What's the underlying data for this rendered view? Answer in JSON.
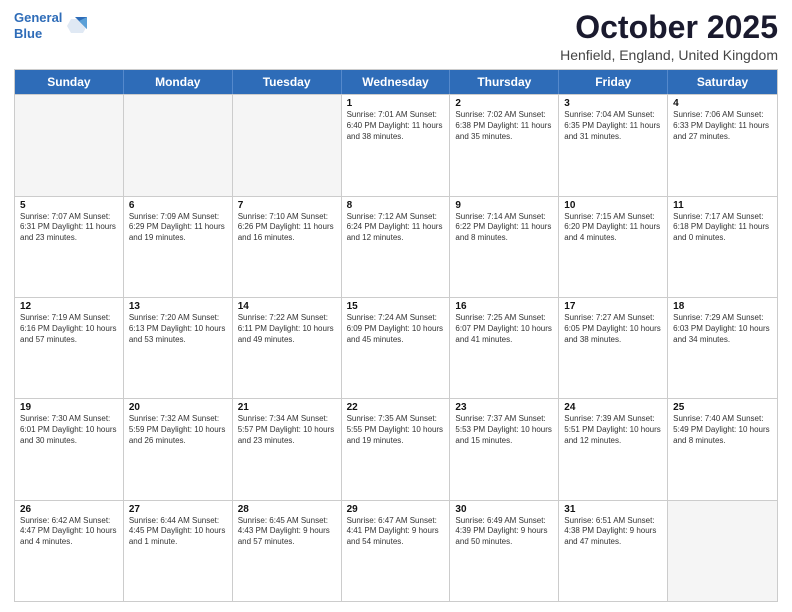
{
  "logo": {
    "line1": "General",
    "line2": "Blue"
  },
  "header": {
    "month": "October 2025",
    "location": "Henfield, England, United Kingdom"
  },
  "days": [
    "Sunday",
    "Monday",
    "Tuesday",
    "Wednesday",
    "Thursday",
    "Friday",
    "Saturday"
  ],
  "rows": [
    [
      {
        "day": "",
        "empty": true
      },
      {
        "day": "",
        "empty": true
      },
      {
        "day": "",
        "empty": true
      },
      {
        "day": "1",
        "info": "Sunrise: 7:01 AM\nSunset: 6:40 PM\nDaylight: 11 hours\nand 38 minutes."
      },
      {
        "day": "2",
        "info": "Sunrise: 7:02 AM\nSunset: 6:38 PM\nDaylight: 11 hours\nand 35 minutes."
      },
      {
        "day": "3",
        "info": "Sunrise: 7:04 AM\nSunset: 6:35 PM\nDaylight: 11 hours\nand 31 minutes."
      },
      {
        "day": "4",
        "info": "Sunrise: 7:06 AM\nSunset: 6:33 PM\nDaylight: 11 hours\nand 27 minutes."
      }
    ],
    [
      {
        "day": "5",
        "info": "Sunrise: 7:07 AM\nSunset: 6:31 PM\nDaylight: 11 hours\nand 23 minutes."
      },
      {
        "day": "6",
        "info": "Sunrise: 7:09 AM\nSunset: 6:29 PM\nDaylight: 11 hours\nand 19 minutes."
      },
      {
        "day": "7",
        "info": "Sunrise: 7:10 AM\nSunset: 6:26 PM\nDaylight: 11 hours\nand 16 minutes."
      },
      {
        "day": "8",
        "info": "Sunrise: 7:12 AM\nSunset: 6:24 PM\nDaylight: 11 hours\nand 12 minutes."
      },
      {
        "day": "9",
        "info": "Sunrise: 7:14 AM\nSunset: 6:22 PM\nDaylight: 11 hours\nand 8 minutes."
      },
      {
        "day": "10",
        "info": "Sunrise: 7:15 AM\nSunset: 6:20 PM\nDaylight: 11 hours\nand 4 minutes."
      },
      {
        "day": "11",
        "info": "Sunrise: 7:17 AM\nSunset: 6:18 PM\nDaylight: 11 hours\nand 0 minutes."
      }
    ],
    [
      {
        "day": "12",
        "info": "Sunrise: 7:19 AM\nSunset: 6:16 PM\nDaylight: 10 hours\nand 57 minutes."
      },
      {
        "day": "13",
        "info": "Sunrise: 7:20 AM\nSunset: 6:13 PM\nDaylight: 10 hours\nand 53 minutes."
      },
      {
        "day": "14",
        "info": "Sunrise: 7:22 AM\nSunset: 6:11 PM\nDaylight: 10 hours\nand 49 minutes."
      },
      {
        "day": "15",
        "info": "Sunrise: 7:24 AM\nSunset: 6:09 PM\nDaylight: 10 hours\nand 45 minutes."
      },
      {
        "day": "16",
        "info": "Sunrise: 7:25 AM\nSunset: 6:07 PM\nDaylight: 10 hours\nand 41 minutes."
      },
      {
        "day": "17",
        "info": "Sunrise: 7:27 AM\nSunset: 6:05 PM\nDaylight: 10 hours\nand 38 minutes."
      },
      {
        "day": "18",
        "info": "Sunrise: 7:29 AM\nSunset: 6:03 PM\nDaylight: 10 hours\nand 34 minutes."
      }
    ],
    [
      {
        "day": "19",
        "info": "Sunrise: 7:30 AM\nSunset: 6:01 PM\nDaylight: 10 hours\nand 30 minutes."
      },
      {
        "day": "20",
        "info": "Sunrise: 7:32 AM\nSunset: 5:59 PM\nDaylight: 10 hours\nand 26 minutes."
      },
      {
        "day": "21",
        "info": "Sunrise: 7:34 AM\nSunset: 5:57 PM\nDaylight: 10 hours\nand 23 minutes."
      },
      {
        "day": "22",
        "info": "Sunrise: 7:35 AM\nSunset: 5:55 PM\nDaylight: 10 hours\nand 19 minutes."
      },
      {
        "day": "23",
        "info": "Sunrise: 7:37 AM\nSunset: 5:53 PM\nDaylight: 10 hours\nand 15 minutes."
      },
      {
        "day": "24",
        "info": "Sunrise: 7:39 AM\nSunset: 5:51 PM\nDaylight: 10 hours\nand 12 minutes."
      },
      {
        "day": "25",
        "info": "Sunrise: 7:40 AM\nSunset: 5:49 PM\nDaylight: 10 hours\nand 8 minutes."
      }
    ],
    [
      {
        "day": "26",
        "info": "Sunrise: 6:42 AM\nSunset: 4:47 PM\nDaylight: 10 hours\nand 4 minutes."
      },
      {
        "day": "27",
        "info": "Sunrise: 6:44 AM\nSunset: 4:45 PM\nDaylight: 10 hours\nand 1 minute."
      },
      {
        "day": "28",
        "info": "Sunrise: 6:45 AM\nSunset: 4:43 PM\nDaylight: 9 hours\nand 57 minutes."
      },
      {
        "day": "29",
        "info": "Sunrise: 6:47 AM\nSunset: 4:41 PM\nDaylight: 9 hours\nand 54 minutes."
      },
      {
        "day": "30",
        "info": "Sunrise: 6:49 AM\nSunset: 4:39 PM\nDaylight: 9 hours\nand 50 minutes."
      },
      {
        "day": "31",
        "info": "Sunrise: 6:51 AM\nSunset: 4:38 PM\nDaylight: 9 hours\nand 47 minutes."
      },
      {
        "day": "",
        "empty": true
      }
    ]
  ]
}
